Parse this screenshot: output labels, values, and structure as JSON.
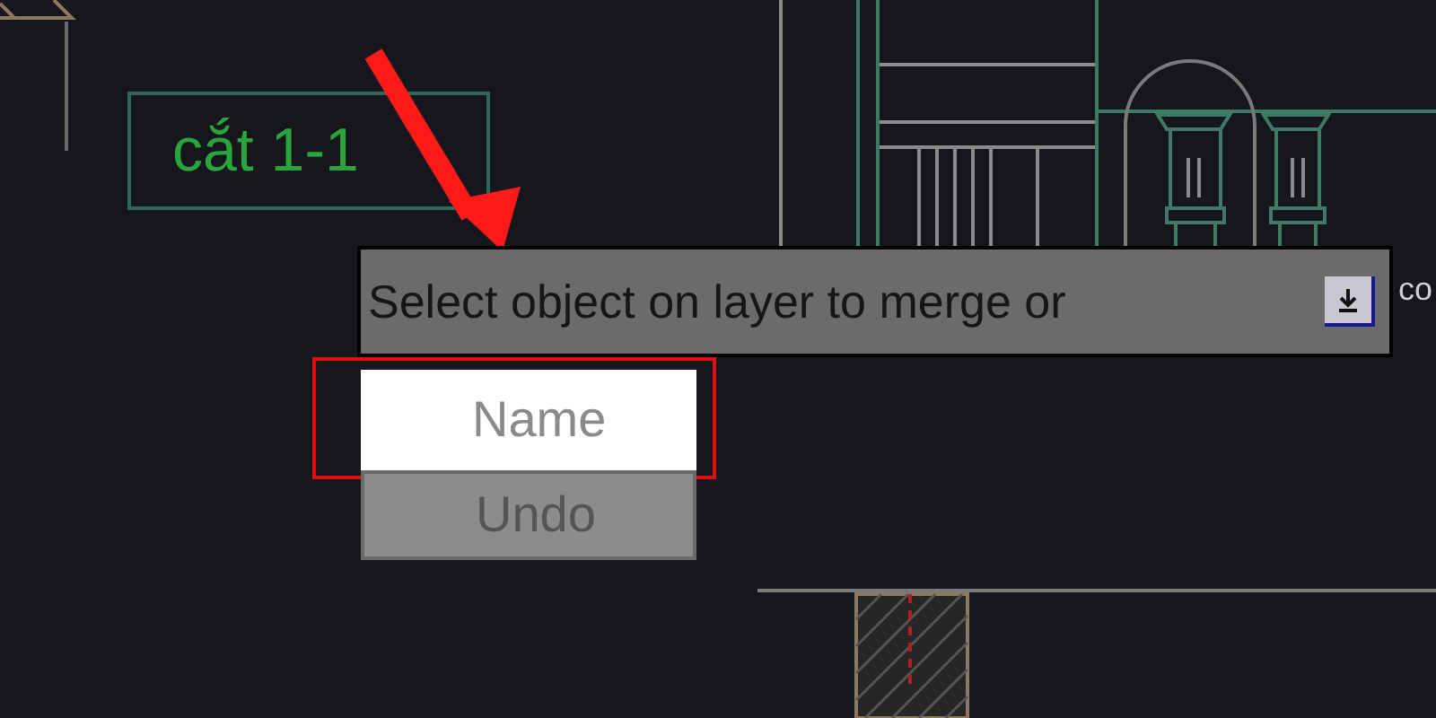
{
  "canvas": {
    "labels": [
      {
        "text": "cắt 1-1",
        "kind": "section"
      },
      {
        "text": "co",
        "kind": "plain"
      }
    ]
  },
  "tooltip": {
    "text": "Select object on layer to merge or"
  },
  "menu": {
    "items": [
      {
        "label": "Name",
        "selected": true
      },
      {
        "label": "Undo",
        "selected": false
      }
    ]
  }
}
